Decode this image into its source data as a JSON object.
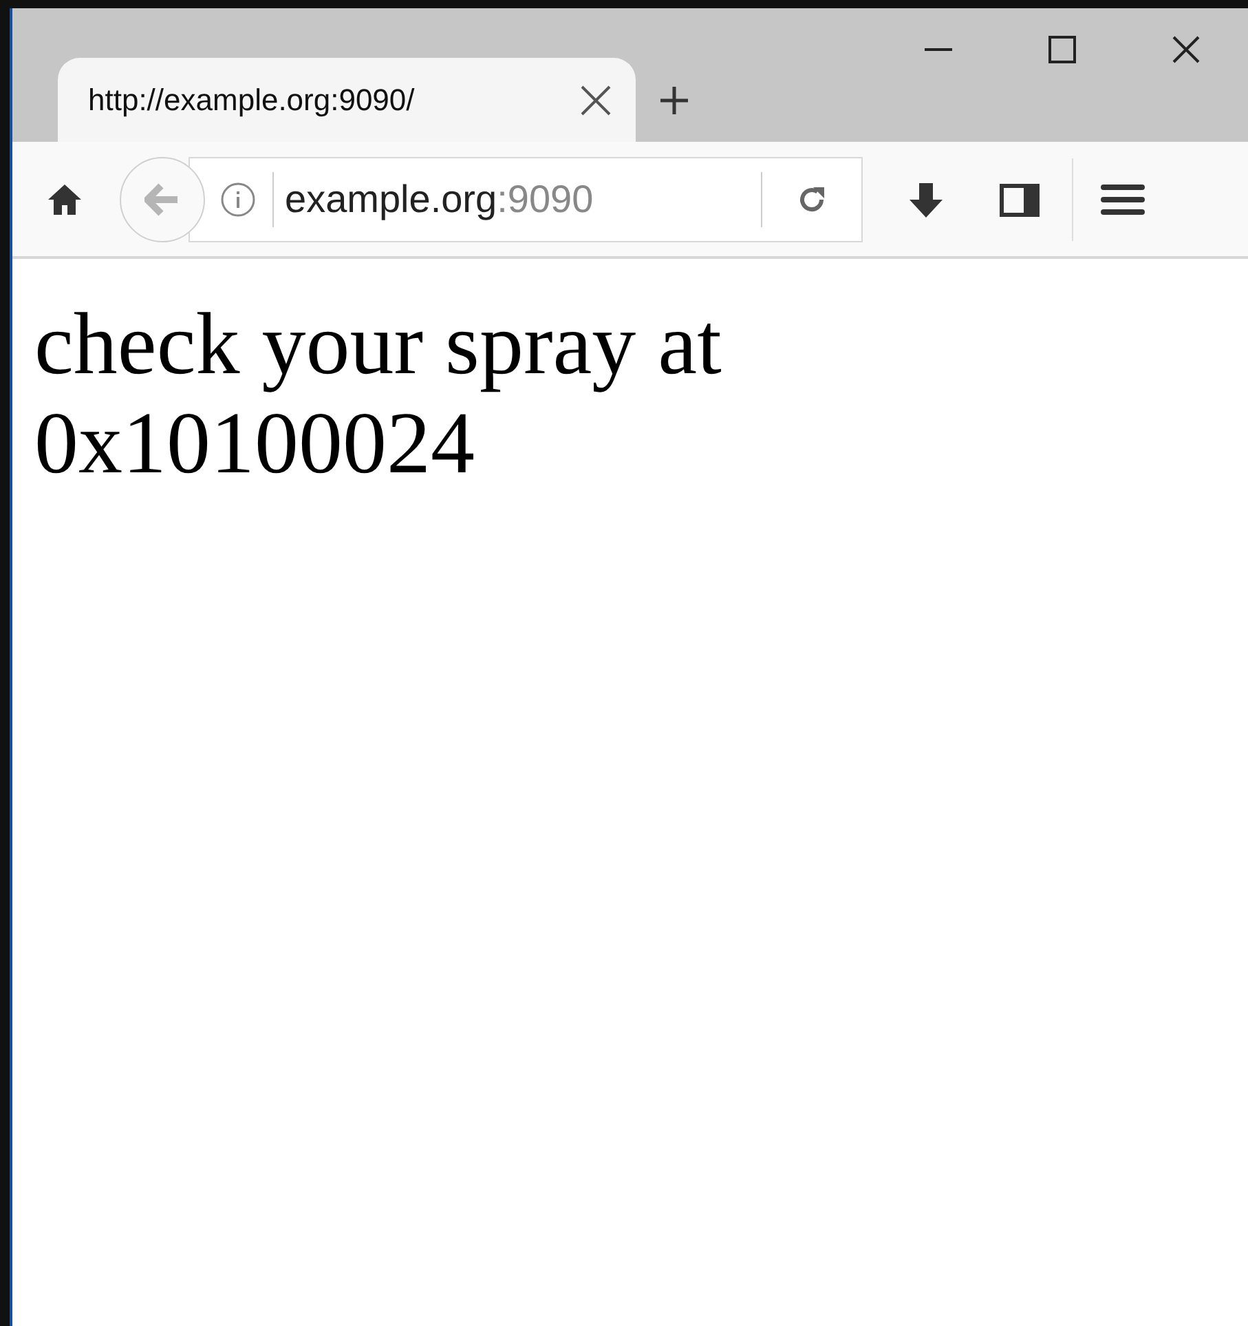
{
  "tab": {
    "title": "http://example.org:9090/",
    "selected": true
  },
  "address_bar": {
    "host": "example.org",
    "port": ":9090"
  },
  "page": {
    "text": "check your spray at 0x10100024"
  }
}
